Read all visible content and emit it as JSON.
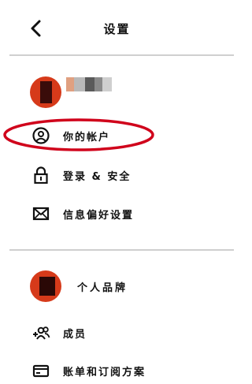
{
  "header": {
    "title": "设置",
    "back_icon": "chevron-left-icon"
  },
  "account": {
    "name_hidden": true
  },
  "account_menu": [
    {
      "label": "你的帐户",
      "icon": "user-circle-icon"
    },
    {
      "label": "登录 & 安全",
      "icon": "lock-icon"
    },
    {
      "label": "信息偏好设置",
      "icon": "mail-icon"
    }
  ],
  "brand": {
    "label": "个人品牌"
  },
  "brand_menu": [
    {
      "label": "成员",
      "icon": "members-add-icon"
    },
    {
      "label": "账单和订阅方案",
      "icon": "card-icon"
    }
  ],
  "colors": {
    "avatar": "#d63a1a",
    "annotation": "#d0021b",
    "divider": "#cfcfcf"
  }
}
